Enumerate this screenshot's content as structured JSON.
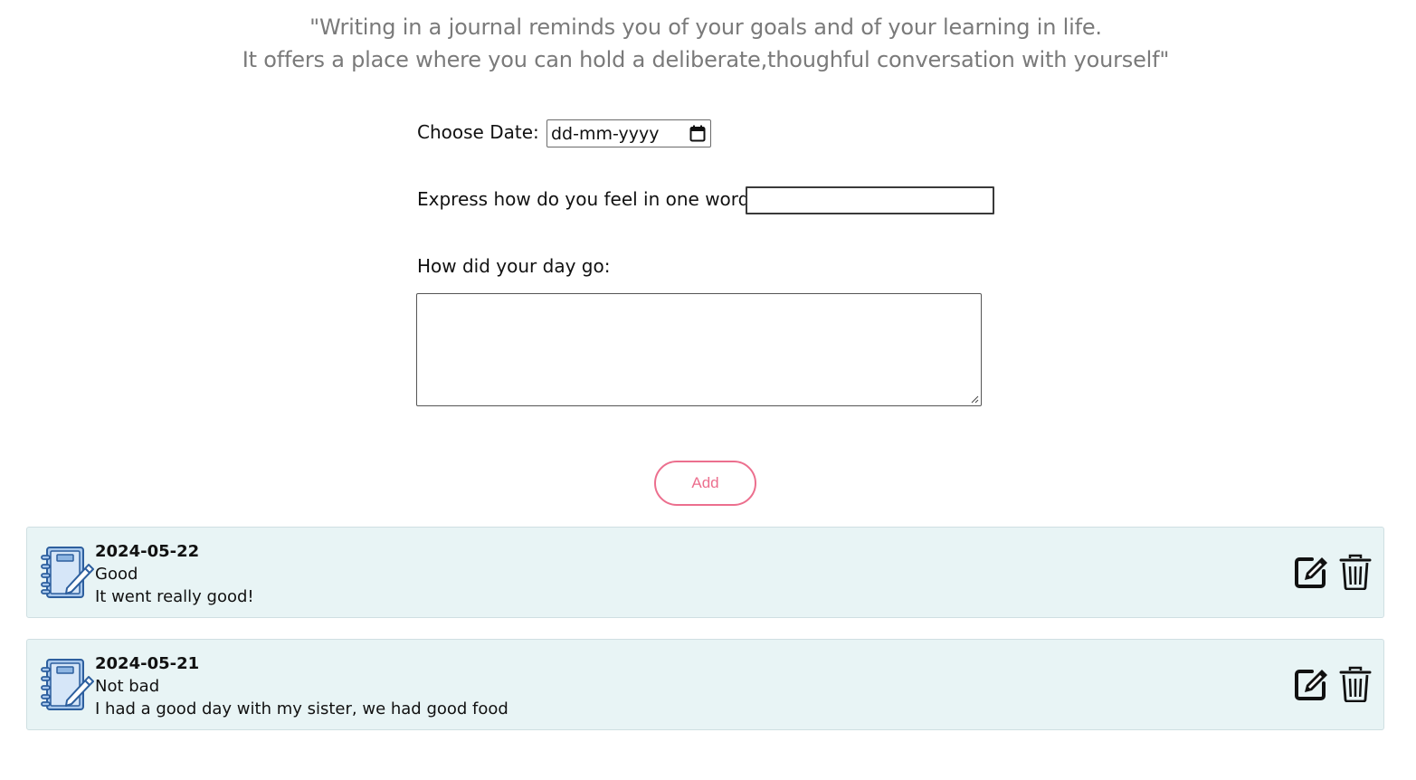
{
  "quote": {
    "line1": "\"Writing in a journal reminds you of your goals and of your learning in life.",
    "line2": "It offers a place where you can hold a deliberate,thoughful conversation with yourself\""
  },
  "form": {
    "date_label": "Choose Date:",
    "date_placeholder": "dd-mm-yyyy",
    "mood_label": "Express how do you feel in one word",
    "mood_value": "",
    "day_label": "How did your day go:",
    "day_value": "",
    "add_button": "Add"
  },
  "colors": {
    "quote_text": "#7a7a7a",
    "add_accent": "#ec6f8e",
    "entry_background": "#e8f4f5",
    "journal_icon": "#4a7ab5"
  },
  "entries": [
    {
      "date": "2024-05-22",
      "mood": "Good",
      "description": "It went really good!",
      "icon": "journal-icon",
      "actions": [
        "edit-icon",
        "trash-icon"
      ]
    },
    {
      "date": "2024-05-21",
      "mood": "Not bad",
      "description": "I had a good day with my sister, we had good food",
      "icon": "journal-icon",
      "actions": [
        "edit-icon",
        "trash-icon"
      ]
    }
  ]
}
